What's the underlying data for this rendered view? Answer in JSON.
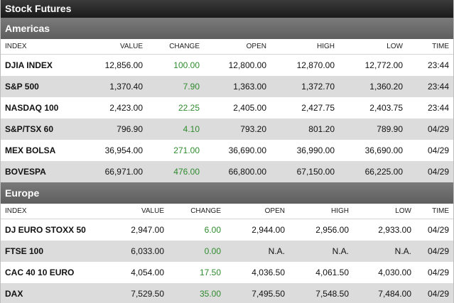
{
  "title": "Stock Futures",
  "colors": {
    "change_positive": "#2e8b2e",
    "title_bg": "#2a2a2a",
    "region_bg": "#6b6b6b",
    "alt_row": "#dcdcdc"
  },
  "americas": {
    "label": "Americas",
    "headers": [
      "INDEX",
      "VALUE",
      "CHANGE",
      "OPEN",
      "HIGH",
      "LOW",
      "TIME"
    ],
    "rows": [
      [
        "DJIA INDEX",
        "12,856.00",
        "100.00",
        "12,800.00",
        "12,870.00",
        "12,772.00",
        "23:44"
      ],
      [
        "S&P 500",
        "1,370.40",
        "7.90",
        "1,363.00",
        "1,372.70",
        "1,360.20",
        "23:44"
      ],
      [
        "NASDAQ 100",
        "2,423.00",
        "22.25",
        "2,405.00",
        "2,427.75",
        "2,403.75",
        "23:44"
      ],
      [
        "S&P/TSX 60",
        "796.90",
        "4.10",
        "793.20",
        "801.20",
        "789.90",
        "04/29"
      ],
      [
        "MEX BOLSA",
        "36,954.00",
        "271.00",
        "36,690.00",
        "36,990.00",
        "36,690.00",
        "04/29"
      ],
      [
        "BOVESPA",
        "66,971.00",
        "476.00",
        "66,800.00",
        "67,150.00",
        "66,225.00",
        "04/29"
      ]
    ]
  },
  "europe": {
    "label": "Europe",
    "headers": [
      "INDEX",
      "VALUE",
      "CHANGE",
      "OPEN",
      "HIGH",
      "LOW",
      "TIME"
    ],
    "rows": [
      [
        "DJ EURO STOXX 50",
        "2,947.00",
        "6.00",
        "2,944.00",
        "2,956.00",
        "2,933.00",
        "04/29"
      ],
      [
        "FTSE 100",
        "6,033.00",
        "0.00",
        "N.A.",
        "N.A.",
        "N.A.",
        "04/29"
      ],
      [
        "CAC 40 10 EURO",
        "4,054.00",
        "17.50",
        "4,036.50",
        "4,061.50",
        "4,030.00",
        "04/29"
      ],
      [
        "DAX",
        "7,529.50",
        "35.00",
        "7,495.50",
        "7,548.50",
        "7,484.00",
        "04/29"
      ]
    ]
  }
}
